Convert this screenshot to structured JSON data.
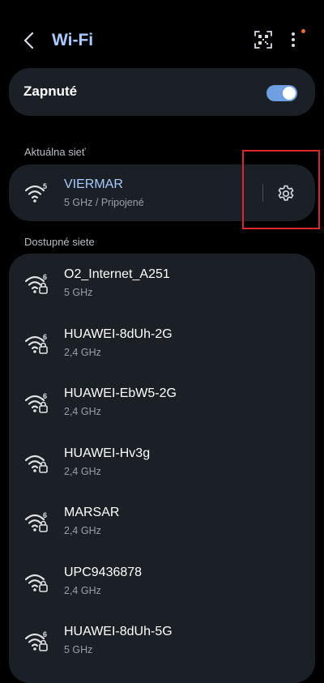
{
  "header": {
    "title": "Wi-Fi",
    "back_icon": "chevron-left-icon",
    "qr_icon": "qr-scan-icon",
    "more_icon": "more-vert-icon",
    "accent_color": "#aacbff",
    "notification_dot_color": "#f06a3c"
  },
  "toggle": {
    "label": "Zapnuté",
    "state": "on",
    "color": "#6f9fe0"
  },
  "current": {
    "section_label": "Aktuálna sieť",
    "network": {
      "name": "VIERMAR",
      "detail": "5 GHz / Pripojené",
      "wifi_gen": "5",
      "locked": false,
      "signal_icon": "wifi-signal-icon"
    },
    "settings_icon": "gear-icon",
    "highlight_color": "#d9282f"
  },
  "available": {
    "section_label": "Dostupné siete",
    "networks": [
      {
        "name": "O2_Internet_A251",
        "detail": "5 GHz",
        "wifi_gen": "6",
        "locked": true
      },
      {
        "name": "HUAWEI-8dUh-2G",
        "detail": "2,4 GHz",
        "wifi_gen": "6",
        "locked": true
      },
      {
        "name": "HUAWEI-EbW5-2G",
        "detail": "2,4 GHz",
        "wifi_gen": "6",
        "locked": true
      },
      {
        "name": "HUAWEI-Hv3g",
        "detail": "2,4 GHz",
        "wifi_gen": "",
        "locked": true
      },
      {
        "name": "MARSAR",
        "detail": "2,4 GHz",
        "wifi_gen": "6",
        "locked": true
      },
      {
        "name": "UPC9436878",
        "detail": "2,4 GHz",
        "wifi_gen": "",
        "locked": true
      },
      {
        "name": "HUAWEI-8dUh-5G",
        "detail": "5 GHz",
        "wifi_gen": "6",
        "locked": true
      }
    ]
  }
}
